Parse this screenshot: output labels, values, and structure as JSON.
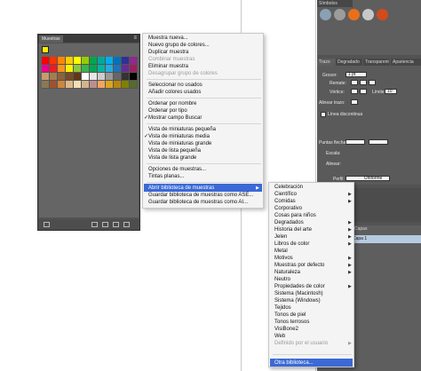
{
  "swatches_panel": {
    "tab": "Muestras",
    "menu_icon": "panel-menu-icon",
    "swatches": [
      "#ff0000",
      "#ff3300",
      "#ff8800",
      "#ffcc00",
      "#ffff00",
      "#99cc00",
      "#00a650",
      "#00a99d",
      "#00aeef",
      "#0072bc",
      "#2e3192",
      "#92278f",
      "#ec008c",
      "#ed1c24",
      "#f7941d",
      "#fff200",
      "#8dc63f",
      "#39b54a",
      "#00a651",
      "#00b4a0",
      "#27aae1",
      "#1c75bc",
      "#662d91",
      "#9e1f63",
      "#c69c6d",
      "#a67c52",
      "#8c6239",
      "#754c24",
      "#603913",
      "#ffffff",
      "#e6e6e6",
      "#cccccc",
      "#999999",
      "#666666",
      "#333333",
      "#000000",
      "#8c7853",
      "#a0522d",
      "#cd853f",
      "#deb887",
      "#f5deb3",
      "#d2b48c",
      "#bc8f8f",
      "#f4a460",
      "#daa520",
      "#b8860b",
      "#808000",
      "#556b2f"
    ]
  },
  "context_menu": {
    "items": [
      {
        "label": "Muestra nueva...",
        "disabled": false
      },
      {
        "label": "Nuevo grupo de colores...",
        "disabled": false
      },
      {
        "label": "Duplicar muestra",
        "disabled": false
      },
      {
        "label": "Combinar muestras",
        "disabled": true
      },
      {
        "label": "Eliminar muestra",
        "disabled": false
      },
      {
        "label": "Desagrupar grupo de colores",
        "disabled": true
      },
      {
        "label": "Seleccionar no usados",
        "disabled": false
      },
      {
        "label": "Añadir colores usados",
        "disabled": false
      },
      {
        "label": "Ordenar por nombre",
        "disabled": false
      },
      {
        "label": "Ordenar por tipo",
        "disabled": false
      },
      {
        "label": "Mostrar campo Buscar",
        "disabled": false,
        "checked": true
      },
      {
        "label": "Vista de miniaturas pequeña",
        "disabled": false
      },
      {
        "label": "Vista de miniaturas media",
        "disabled": false,
        "checked": true
      },
      {
        "label": "Vista de miniaturas grande",
        "disabled": false
      },
      {
        "label": "Vista de lista pequeña",
        "disabled": false
      },
      {
        "label": "Vista de lista grande",
        "disabled": false
      },
      {
        "label": "Opciones de muestras...",
        "disabled": false
      },
      {
        "label": "Tintas planas...",
        "disabled": false
      },
      {
        "label": "Abrir biblioteca de muestras",
        "disabled": false,
        "highlighted": true,
        "submenu": true
      },
      {
        "label": "Guardar biblioteca de muestras como ASE...",
        "disabled": false
      },
      {
        "label": "Guardar biblioteca de muestras como AI...",
        "disabled": false
      }
    ]
  },
  "submenu": {
    "items": [
      {
        "label": "Celebración",
        "arrow": false
      },
      {
        "label": "Científico",
        "arrow": true
      },
      {
        "label": "Comidas",
        "arrow": true
      },
      {
        "label": "Corporativo",
        "arrow": false
      },
      {
        "label": "Cosas para niños",
        "arrow": false
      },
      {
        "label": "Degradados",
        "arrow": true
      },
      {
        "label": "Historia del arte",
        "arrow": true
      },
      {
        "label": "Jelen",
        "arrow": true
      },
      {
        "label": "Libros de color",
        "arrow": true
      },
      {
        "label": "Metal",
        "arrow": false
      },
      {
        "label": "Motivos",
        "arrow": true
      },
      {
        "label": "Muestras por defecto",
        "arrow": true
      },
      {
        "label": "Naturaleza",
        "arrow": true
      },
      {
        "label": "Neutro",
        "arrow": false
      },
      {
        "label": "Propiedades de color",
        "arrow": true
      },
      {
        "label": "Sistema (Macintosh)",
        "arrow": false
      },
      {
        "label": "Sistema (Windows)",
        "arrow": false
      },
      {
        "label": "Tejidos",
        "arrow": false
      },
      {
        "label": "Tonos de piel",
        "arrow": false
      },
      {
        "label": "Tonos terrosos",
        "arrow": false
      },
      {
        "label": "VisiBone2",
        "arrow": false
      },
      {
        "label": "Web",
        "arrow": false
      },
      {
        "label": "Definido por el usuario",
        "arrow": true,
        "disabled": true
      },
      {
        "label": "Otra biblioteca...",
        "arrow": false,
        "highlighted": true
      }
    ]
  },
  "right_panel": {
    "symbols_tab": "Símbolos",
    "stroke_tabs": [
      "Trazo",
      "Degradado",
      "Transparent",
      "Apariencia"
    ],
    "grosor_label": "Grosor:",
    "grosor_value": "1 pt",
    "remate_label": "Remate:",
    "vertice_label": "Vértice:",
    "limite_label": "Límite:",
    "limite_value": "10",
    "alinear_label": "Alinear trazo:",
    "discontinua_label": "Línea discontinua",
    "puntas_label": "Puntas flecha:",
    "escala_label": "Escala:",
    "alinear2_label": "Alinear:",
    "perfil_label": "Perfil:",
    "perfil_value": "Uniforme",
    "capas_tab": "Capas",
    "capa_label": "Capa 1"
  }
}
